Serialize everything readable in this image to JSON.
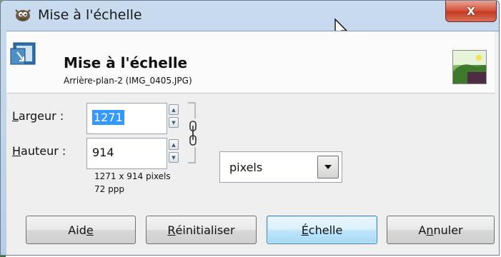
{
  "window": {
    "title": "Mise à l'échelle",
    "close_symbol": "X",
    "icon": "gimp-wilber-icon"
  },
  "header": {
    "title": "Mise à l'échelle",
    "subtitle": "Arrière-plan-2 (IMG_0405.JPG)",
    "icon": "scale-layer-icon",
    "thumbnail": "layer-thumbnail"
  },
  "form": {
    "width_label_mnemonic": "L",
    "width_label_rest": "argeur :",
    "width_value": "1271",
    "height_label_mnemonic": "H",
    "height_label_rest": "auteur :",
    "height_value": "914",
    "chain_icon": "chain-link-icon",
    "unit": "pixels",
    "size_info": "1271 x 914 pixels",
    "resolution_info": "72 ppp"
  },
  "buttons": {
    "help_pre": "Aid",
    "help_mn": "e",
    "reset_mn": "R",
    "reset_post": "éinitialiser",
    "scale_mn": "É",
    "scale_post": "chelle",
    "cancel_pre": "A",
    "cancel_mn": "n",
    "cancel_post": "nuler"
  },
  "colors": {
    "selection": "#3399ff",
    "default_button": "#bee6fd",
    "close_button": "#c23b22",
    "titlebar": "#c9dbee"
  }
}
